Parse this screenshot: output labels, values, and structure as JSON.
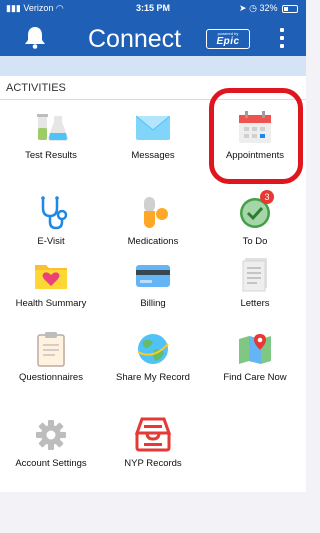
{
  "status_bar": {
    "carrier": "Verizon",
    "time": "3:15 PM",
    "battery": "32%",
    "battery_fraction": 0.32
  },
  "header": {
    "title": "Connect",
    "brand_small": "powered by",
    "brand": "Epic",
    "bell_icon": "bell-icon",
    "menu_icon": "more-vertical-icon",
    "color": "#1f5fb5"
  },
  "section": {
    "label": "ACTIVITIES"
  },
  "activities": [
    {
      "label": "Test Results",
      "icon": "test-tubes-icon"
    },
    {
      "label": "Messages",
      "icon": "envelope-icon"
    },
    {
      "label": "Appointments",
      "icon": "calendar-icon",
      "highlighted": true
    },
    {
      "label": "E-Visit",
      "icon": "stethoscope-icon"
    },
    {
      "label": "Medications",
      "icon": "pill-icon"
    },
    {
      "label": "To Do",
      "icon": "checkmark-icon",
      "badge": "3"
    },
    {
      "label": "Health Summary",
      "icon": "heart-folder-icon"
    },
    {
      "label": "Billing",
      "icon": "credit-card-icon"
    },
    {
      "label": "Letters",
      "icon": "letters-icon"
    },
    {
      "label": "Questionnaires",
      "icon": "clipboard-icon"
    },
    {
      "label": "Share My Record",
      "icon": "globe-icon"
    },
    {
      "label": "Find Care Now",
      "icon": "map-pin-icon"
    },
    {
      "label": "Account Settings",
      "icon": "gear-icon"
    },
    {
      "label": "NYP Records",
      "icon": "inbox-tray-icon"
    }
  ],
  "colors": {
    "accent": "#1f5fb5",
    "highlight": "#e0161e",
    "badge": "#e53935"
  }
}
